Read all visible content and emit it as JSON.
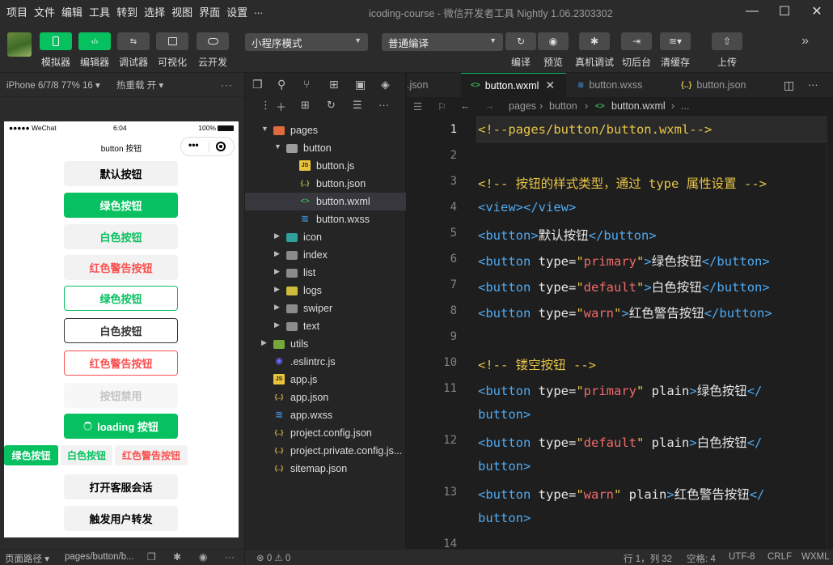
{
  "menu": [
    "项目",
    "文件",
    "编辑",
    "工具",
    "转到",
    "选择",
    "视图",
    "界面",
    "设置",
    "..."
  ],
  "window_title": "icoding-course - 微信开发者工具 Nightly 1.06.2303302",
  "window_controls": {
    "minimize": "—",
    "maximize": "☐",
    "close": "✕"
  },
  "toolbar": {
    "buttons": [
      {
        "label": "模拟器",
        "icon": "phone-icon"
      },
      {
        "label": "编辑器",
        "icon": "code-icon"
      },
      {
        "label": "调试器",
        "icon": "debug-icon"
      },
      {
        "label": "可视化",
        "icon": "layout-icon"
      },
      {
        "label": "云开发",
        "icon": "cloud-icon"
      }
    ],
    "mode_select": "小程序模式",
    "compile_select": "普通编译",
    "actions": [
      {
        "label": "编译",
        "icon": "refresh-icon"
      },
      {
        "label": "预览",
        "icon": "eye-icon"
      },
      {
        "label": "真机调试",
        "icon": "bug-icon"
      },
      {
        "label": "切后台",
        "icon": "switch-icon"
      },
      {
        "label": "清缓存",
        "icon": "layers-icon"
      },
      {
        "label": "上传",
        "icon": "upload-icon"
      }
    ],
    "more": "»"
  },
  "simulator": {
    "device": "iPhone 6/7/8 77% 16 ▾",
    "hot_reload": "热重载 开 ▾",
    "menu": "···",
    "status_left": "●●●●● WeChat",
    "status_time": "6:04",
    "status_battery": "100%",
    "nav_title": "button 按钮",
    "buttons": {
      "default": "默认按钮",
      "primary": "绿色按钮",
      "white": "白色按钮",
      "warn": "红色警告按钮",
      "plain_primary": "绿色按钮",
      "plain_default": "白色按钮",
      "plain_warn": "红色警告按钮",
      "disabled": "按钮禁用",
      "loading": "loading 按钮",
      "mini_primary": "绿色按钮",
      "mini_default": "白色按钮",
      "mini_warn": "红色警告按钮",
      "contact": "打开客服会话",
      "share": "触发用户转发"
    },
    "footer_label": "页面路径 ▾",
    "footer_path": "pages/button/b..."
  },
  "explorer": {
    "tree": [
      {
        "name": "pages",
        "kind": "folder-pages",
        "depth": 1,
        "open": true
      },
      {
        "name": "button",
        "kind": "folder-open",
        "depth": 2,
        "open": true
      },
      {
        "name": "button.js",
        "kind": "js",
        "depth": 3
      },
      {
        "name": "button.json",
        "kind": "json",
        "depth": 3
      },
      {
        "name": "button.wxml",
        "kind": "wxml",
        "depth": 3,
        "selected": true
      },
      {
        "name": "button.wxss",
        "kind": "wxss",
        "depth": 3
      },
      {
        "name": "icon",
        "kind": "folder-icon",
        "depth": 2
      },
      {
        "name": "index",
        "kind": "folder",
        "depth": 2
      },
      {
        "name": "list",
        "kind": "folder",
        "depth": 2
      },
      {
        "name": "logs",
        "kind": "folder-logs",
        "depth": 2
      },
      {
        "name": "swiper",
        "kind": "folder",
        "depth": 2
      },
      {
        "name": "text",
        "kind": "folder",
        "depth": 2
      },
      {
        "name": "utils",
        "kind": "folder-utils",
        "depth": 1
      },
      {
        "name": ".eslintrc.js",
        "kind": "eslint",
        "depth": 1
      },
      {
        "name": "app.js",
        "kind": "js",
        "depth": 1
      },
      {
        "name": "app.json",
        "kind": "json",
        "depth": 1
      },
      {
        "name": "app.wxss",
        "kind": "wxss",
        "depth": 1
      },
      {
        "name": "project.config.json",
        "kind": "json",
        "depth": 1
      },
      {
        "name": "project.private.config.js...",
        "kind": "json",
        "depth": 1
      },
      {
        "name": "sitemap.json",
        "kind": "json",
        "depth": 1
      }
    ]
  },
  "editor": {
    "tabs": [
      {
        "label": ".json",
        "icon": ""
      },
      {
        "label": "button.wxml",
        "icon": "wxml",
        "active": true
      },
      {
        "label": "button.wxss",
        "icon": "wxss"
      },
      {
        "label": "button.json",
        "icon": "json"
      }
    ],
    "breadcrumb": [
      "pages",
      "button",
      "button.wxml",
      "..."
    ],
    "lines": [
      {
        "n": "1",
        "code": [
          [
            "cm",
            "<!--pages/button/button.wxml-->"
          ]
        ]
      },
      {
        "n": "2",
        "code": []
      },
      {
        "n": "3",
        "code": [
          [
            "cm",
            "<!-- 按钮的样式类型，通过 type 属性设置 -->"
          ]
        ]
      },
      {
        "n": "4",
        "code": [
          [
            "tag",
            "<view></view>"
          ]
        ]
      },
      {
        "n": "5",
        "code": [
          [
            "tag",
            "<button>"
          ],
          [
            "tx",
            "默认按钮"
          ],
          [
            "tag",
            "</button>"
          ]
        ]
      },
      {
        "n": "6",
        "code": [
          [
            "tag",
            "<button "
          ],
          [
            "at",
            "type"
          ],
          [
            "eq",
            "="
          ],
          [
            "q",
            "\""
          ],
          [
            "v",
            "primary"
          ],
          [
            "q",
            "\""
          ],
          [
            "tag",
            ">"
          ],
          [
            "tx",
            "绿色按钮"
          ],
          [
            "tag",
            "</button>"
          ]
        ]
      },
      {
        "n": "7",
        "code": [
          [
            "tag",
            "<button "
          ],
          [
            "at",
            "type"
          ],
          [
            "eq",
            "="
          ],
          [
            "q",
            "\""
          ],
          [
            "v",
            "default"
          ],
          [
            "q",
            "\""
          ],
          [
            "tag",
            ">"
          ],
          [
            "tx",
            "白色按钮"
          ],
          [
            "tag",
            "</button>"
          ]
        ]
      },
      {
        "n": "8",
        "code": [
          [
            "tag",
            "<button "
          ],
          [
            "at",
            "type"
          ],
          [
            "eq",
            "="
          ],
          [
            "q",
            "\""
          ],
          [
            "v",
            "warn"
          ],
          [
            "q",
            "\""
          ],
          [
            "tag",
            ">"
          ],
          [
            "tx",
            "红色警告按钮"
          ],
          [
            "tag",
            "</button>"
          ]
        ]
      },
      {
        "n": "9",
        "code": []
      },
      {
        "n": "10",
        "code": [
          [
            "cm",
            "<!-- 镂空按钮 -->"
          ]
        ]
      },
      {
        "n": "11",
        "code": [
          [
            "tag",
            "<button "
          ],
          [
            "at",
            "type"
          ],
          [
            "eq",
            "="
          ],
          [
            "q",
            "\""
          ],
          [
            "v",
            "primary"
          ],
          [
            "q",
            "\""
          ],
          [
            "at",
            " plain"
          ],
          [
            "tag",
            ">"
          ],
          [
            "tx",
            "绿色按钮"
          ],
          [
            "tag",
            "</"
          ]
        ]
      },
      {
        "n": "",
        "code": [
          [
            "tag",
            "button>"
          ]
        ]
      },
      {
        "n": "12",
        "code": [
          [
            "tag",
            "<button "
          ],
          [
            "at",
            "type"
          ],
          [
            "eq",
            "="
          ],
          [
            "q",
            "\""
          ],
          [
            "v",
            "default"
          ],
          [
            "q",
            "\""
          ],
          [
            "at",
            " plain"
          ],
          [
            "tag",
            ">"
          ],
          [
            "tx",
            "白色按钮"
          ],
          [
            "tag",
            "</"
          ]
        ]
      },
      {
        "n": "",
        "code": [
          [
            "tag",
            "button>"
          ]
        ]
      },
      {
        "n": "13",
        "code": [
          [
            "tag",
            "<button "
          ],
          [
            "at",
            "type"
          ],
          [
            "eq",
            "="
          ],
          [
            "q",
            "\""
          ],
          [
            "v",
            "warn"
          ],
          [
            "q",
            "\""
          ],
          [
            "at",
            " plain"
          ],
          [
            "tag",
            ">"
          ],
          [
            "tx",
            "红色警告按钮"
          ],
          [
            "tag",
            "</"
          ]
        ]
      },
      {
        "n": "",
        "code": [
          [
            "tag",
            "button>"
          ]
        ]
      },
      {
        "n": "14",
        "code": []
      }
    ]
  },
  "statusbar": {
    "problems": "⊗ 0 ⚠ 0",
    "position": "行 1，列 32",
    "spaces": "空格: 4",
    "encoding": "UTF-8",
    "eol": "CRLF",
    "language": "WXML"
  },
  "colors": {
    "accent": "#07c160",
    "warn": "#fa5151",
    "comment": "#e7c547",
    "tag": "#4fa9f0",
    "value": "#ef6b6b"
  }
}
